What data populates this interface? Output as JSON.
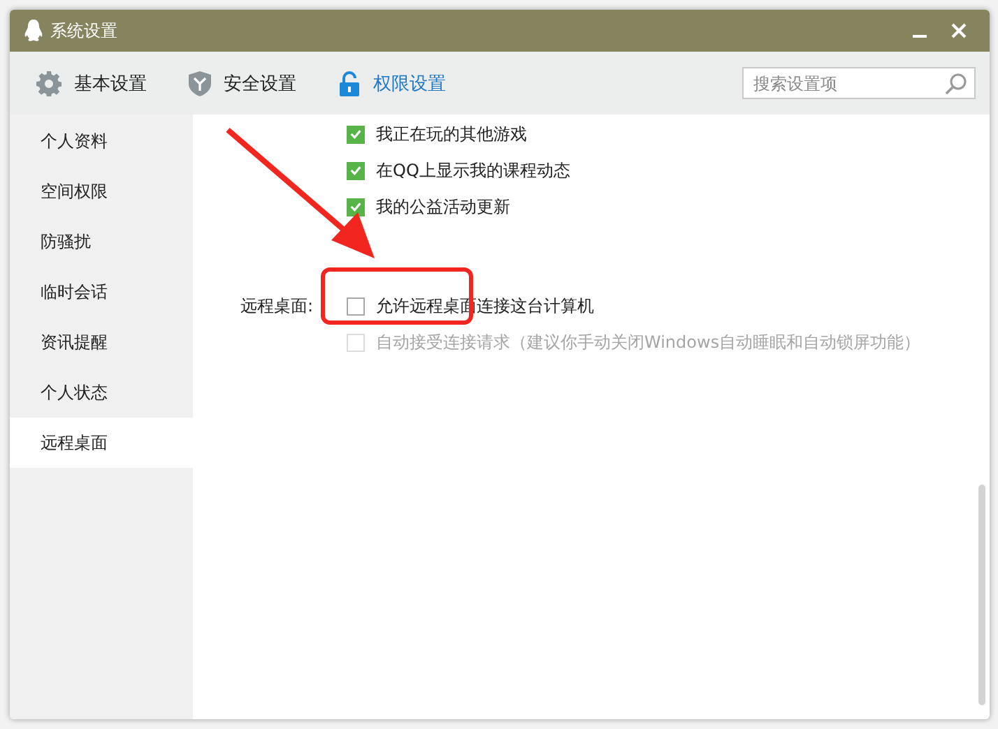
{
  "window": {
    "title": "系统设置"
  },
  "tabs": [
    {
      "label": "基本设置",
      "kind": "gear",
      "selected": false
    },
    {
      "label": "安全设置",
      "kind": "shield",
      "selected": false
    },
    {
      "label": "权限设置",
      "kind": "lock",
      "selected": true
    }
  ],
  "search": {
    "placeholder": "搜索设置项"
  },
  "sidebar": {
    "items": [
      {
        "label": "个人资料",
        "selected": false
      },
      {
        "label": "空间权限",
        "selected": false
      },
      {
        "label": "防骚扰",
        "selected": false
      },
      {
        "label": "临时会话",
        "selected": false
      },
      {
        "label": "资讯提醒",
        "selected": false
      },
      {
        "label": "个人状态",
        "selected": false
      },
      {
        "label": "远程桌面",
        "selected": true
      }
    ]
  },
  "options": [
    {
      "label": "我正在玩的其他游戏",
      "checked": true
    },
    {
      "label": "在QQ上显示我的课程动态",
      "checked": true
    },
    {
      "label": "我的公益活动更新",
      "checked": true
    }
  ],
  "remote_desktop": {
    "label": "远程桌面:",
    "options": [
      {
        "label": "允许远程桌面连接这台计算机",
        "checked": false,
        "disabled": false
      },
      {
        "label": "自动接受连接请求（建议你手动关闭Windows自动睡眠和自动锁屏功能）",
        "checked": false,
        "disabled": true
      }
    ]
  }
}
